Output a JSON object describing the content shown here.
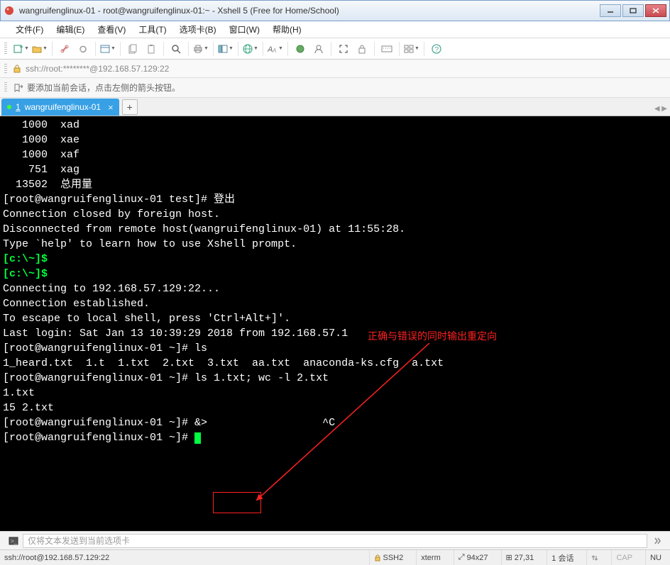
{
  "window": {
    "title": "wangruifenglinux-01 - root@wangruifenglinux-01:~ - Xshell 5 (Free for Home/School)"
  },
  "menu": {
    "file": "文件(F)",
    "edit": "编辑(E)",
    "view": "查看(V)",
    "tools": "工具(T)",
    "tabs": "选项卡(B)",
    "window": "窗口(W)",
    "help": "帮助(H)"
  },
  "address": {
    "text": "ssh://root:********@192.168.57.129:22"
  },
  "hint": {
    "text": "要添加当前会话，点击左侧的箭头按钮。"
  },
  "tab": {
    "index": "1",
    "label": "wangruifenglinux-01"
  },
  "terminal": {
    "l01": "   1000  xad",
    "l02": "   1000  xae",
    "l03": "   1000  xaf",
    "l04": "    751  xag",
    "l05": "  13502  总用量",
    "l06": "[root@wangruifenglinux-01 test]# 登出",
    "l07": "",
    "l08": "Connection closed by foreign host.",
    "l09": "",
    "l10": "Disconnected from remote host(wangruifenglinux-01) at 11:55:28.",
    "l11": "",
    "l12": "Type `help' to learn how to use Xshell prompt.",
    "l13g": "[c:\\~]$ ",
    "l14g": "[c:\\~]$ ",
    "l15": "",
    "l16": "Connecting to 192.168.57.129:22...",
    "l17": "Connection established.",
    "l18": "To escape to local shell, press 'Ctrl+Alt+]'.",
    "l19": "",
    "l20": "Last login: Sat Jan 13 10:39:29 2018 from 192.168.57.1",
    "l21": "[root@wangruifenglinux-01 ~]# ls",
    "l22": "1_heard.txt  1.t  1.txt  2.txt  3.txt  aa.txt  anaconda-ks.cfg  a.txt",
    "l23": "[root@wangruifenglinux-01 ~]# ls 1.txt; wc -l 2.txt",
    "l24": "1.txt",
    "l25": "15 2.txt",
    "l26": "[root@wangruifenglinux-01 ~]# &>                  ^C",
    "l27": "[root@wangruifenglinux-01 ~]# ",
    "annotation_label": "正确与错误的同时输出重定向"
  },
  "bottominput": {
    "placeholder": "仅将文本发送到当前选项卡"
  },
  "status": {
    "left": "ssh://root@192.168.57.129:22",
    "proto": "SSH2",
    "term": "xterm",
    "size": "94x27",
    "pos": "27,31",
    "sessions": "1 会话",
    "cap": "CAP",
    "num": "NU"
  }
}
